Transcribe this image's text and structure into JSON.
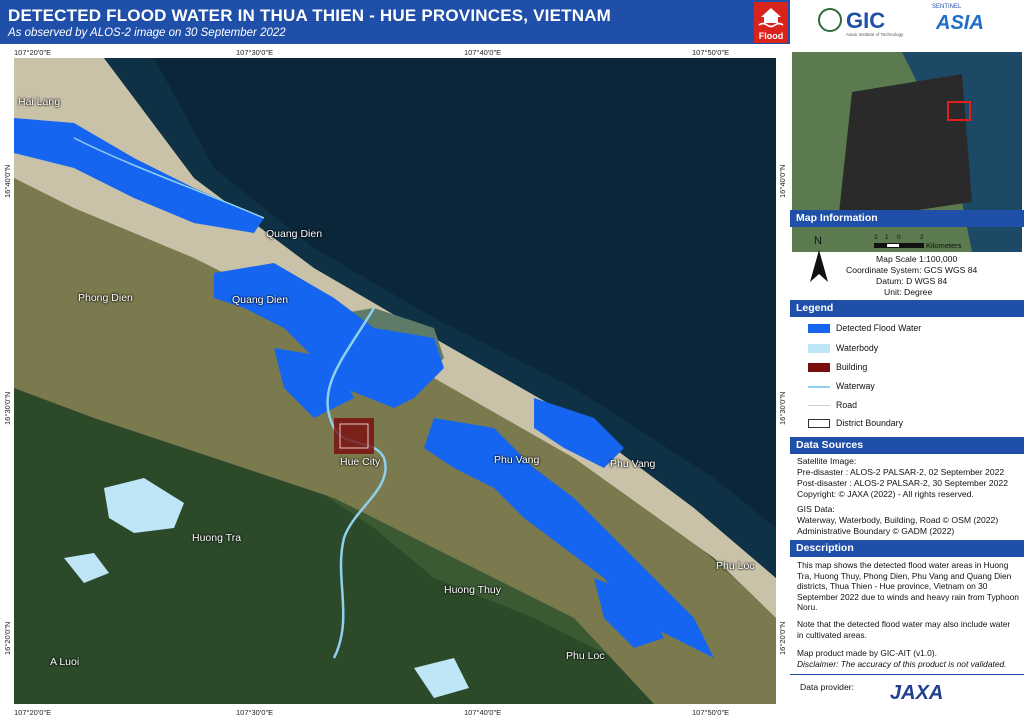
{
  "header": {
    "title": "DETECTED FLOOD WATER IN THUA THIEN - HUE PROVINCES, VIETNAM",
    "subtitle": "As observed by ALOS-2  image on 30 September 2022",
    "badge_label": "Flood",
    "bg_color": "#1f4fa8"
  },
  "logos": {
    "gic_text": "GIC",
    "gic_subtext": "Asian Institute of Technology",
    "sentinel_top": "SENTINEL",
    "sentinel_text": "ASIA"
  },
  "map": {
    "coords_top": [
      "107°20'0\"E",
      "107°30'0\"E",
      "107°40'0\"E",
      "107°50'0\"E"
    ],
    "coords_bottom": [
      "107°20'0\"E",
      "107°30'0\"E",
      "107°40'0\"E",
      "107°50'0\"E"
    ],
    "coords_left": [
      "16°40'0\"N",
      "16°30'0\"N",
      "16°20'0\"N"
    ],
    "coords_right": [
      "16°40'0\"N",
      "16°30'0\"N",
      "16°20'0\"N"
    ],
    "labels": {
      "hai_lang": "Hai Lang",
      "quang_dien_1": "Quang Dien",
      "quang_dien_2": "Quang Dien",
      "phong_dien": "Phong Dien",
      "hue_city": "Hue City",
      "phu_vang_1": "Phu Vang",
      "phu_vang_2": "Phu Vang",
      "huong_tra": "Huong Tra",
      "huong_thuy": "Huong Thuy",
      "phu_loc_1": "Phu Loc",
      "phu_loc_2": "Phu Loc",
      "a_luoi": "A Luoi"
    },
    "flood_color": "#1565f0",
    "waterbody_color": "#bfe6f7"
  },
  "map_information": {
    "heading": "Map Information",
    "north": "N",
    "scale_ticks": [
      "2",
      "1",
      "0",
      "2"
    ],
    "scale_unit": "Kilometers",
    "scale": "Map Scale 1:100,000",
    "coordinate_system": "Coordinate System: GCS WGS 84",
    "datum": "Datum: D WGS 84",
    "unit": "Unit: Degree"
  },
  "legend": {
    "heading": "Legend",
    "items": [
      {
        "label": "Detected Flood Water",
        "color": "#1565f0"
      },
      {
        "label": "Waterbody",
        "color": "#bfe6f7"
      },
      {
        "label": "Building",
        "color": "#7a0d0d"
      },
      {
        "label": "Waterway",
        "color": "#8fd0ee"
      },
      {
        "label": "Road",
        "color": "#e8e8e8"
      },
      {
        "label": "District Boundary",
        "color": "#333333"
      }
    ]
  },
  "data_sources": {
    "heading": "Data Sources",
    "lines": [
      "Satellite Image:",
      "Pre-disaster   : ALOS-2 PALSAR-2, 02 September 2022",
      "Post-disaster  : ALOS-2 PALSAR-2, 30 September 2022",
      "Copyright: © JAXA (2022) - All rights reserved.",
      "",
      "GIS Data:",
      "Waterway, Waterbody, Building, Road © OSM (2022)",
      "Administrative Boundary © GADM (2022)"
    ]
  },
  "description": {
    "heading": "Description",
    "para1": "This map shows the detected flood water areas in Huong Tra, Huong Thuy, Phong Dien, Phu Vang and Quang Dien districts, Thua Thien - Hue  province, Vietnam on 30 September 2022 due to winds and heavy rain from Typhoon Noru.",
    "para2": "Note that the detected flood water may also include water in cultivated areas.",
    "para3": "Map product made by GIC-AIT (v1.0).",
    "disclaimer": "Disclaimer: The accuracy of this product is not validated."
  },
  "data_provider": {
    "label": "Data provider:",
    "logo_text": "JAXA"
  }
}
